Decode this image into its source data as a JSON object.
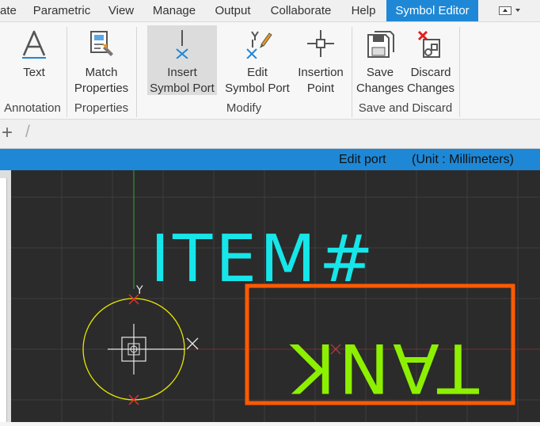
{
  "tabs": [
    {
      "label": "ate"
    },
    {
      "label": "Parametric"
    },
    {
      "label": "View"
    },
    {
      "label": "Manage"
    },
    {
      "label": "Output"
    },
    {
      "label": "Collaborate"
    },
    {
      "label": "Help"
    },
    {
      "label": "Symbol Editor"
    }
  ],
  "ribbon": {
    "text": {
      "line1": "Text"
    },
    "match": {
      "line1": "Match",
      "line2": "Properties"
    },
    "insert_port": {
      "line1": "Insert",
      "line2": "Symbol Port"
    },
    "edit_port": {
      "line1": "Edit",
      "line2": "Symbol Port"
    },
    "insertion_point": {
      "line1": "Insertion",
      "line2": "Point"
    },
    "save": {
      "line1": "Save",
      "line2": "Changes"
    },
    "discard": {
      "line1": "Discard",
      "line2": "Changes"
    },
    "groups": {
      "annotation": "Annotation",
      "properties": "Properties",
      "modify": "Modify",
      "save_discard": "Save and Discard"
    }
  },
  "toolbar": {
    "plus": "+",
    "slash": "/"
  },
  "status": {
    "mode": "Edit port",
    "unit": "(Unit : Millimeters)"
  },
  "drawing": {
    "item_label": "ITEM#",
    "tank_label": "TANK",
    "port_axis": "Y"
  },
  "colors": {
    "accent": "#1e88d6",
    "item_text": "#16e6ea",
    "tank_text": "#8cf000",
    "selection_box": "#ff5a00",
    "symbol_circle": "#e8e800",
    "canvas_bg": "#2b2b2b"
  }
}
